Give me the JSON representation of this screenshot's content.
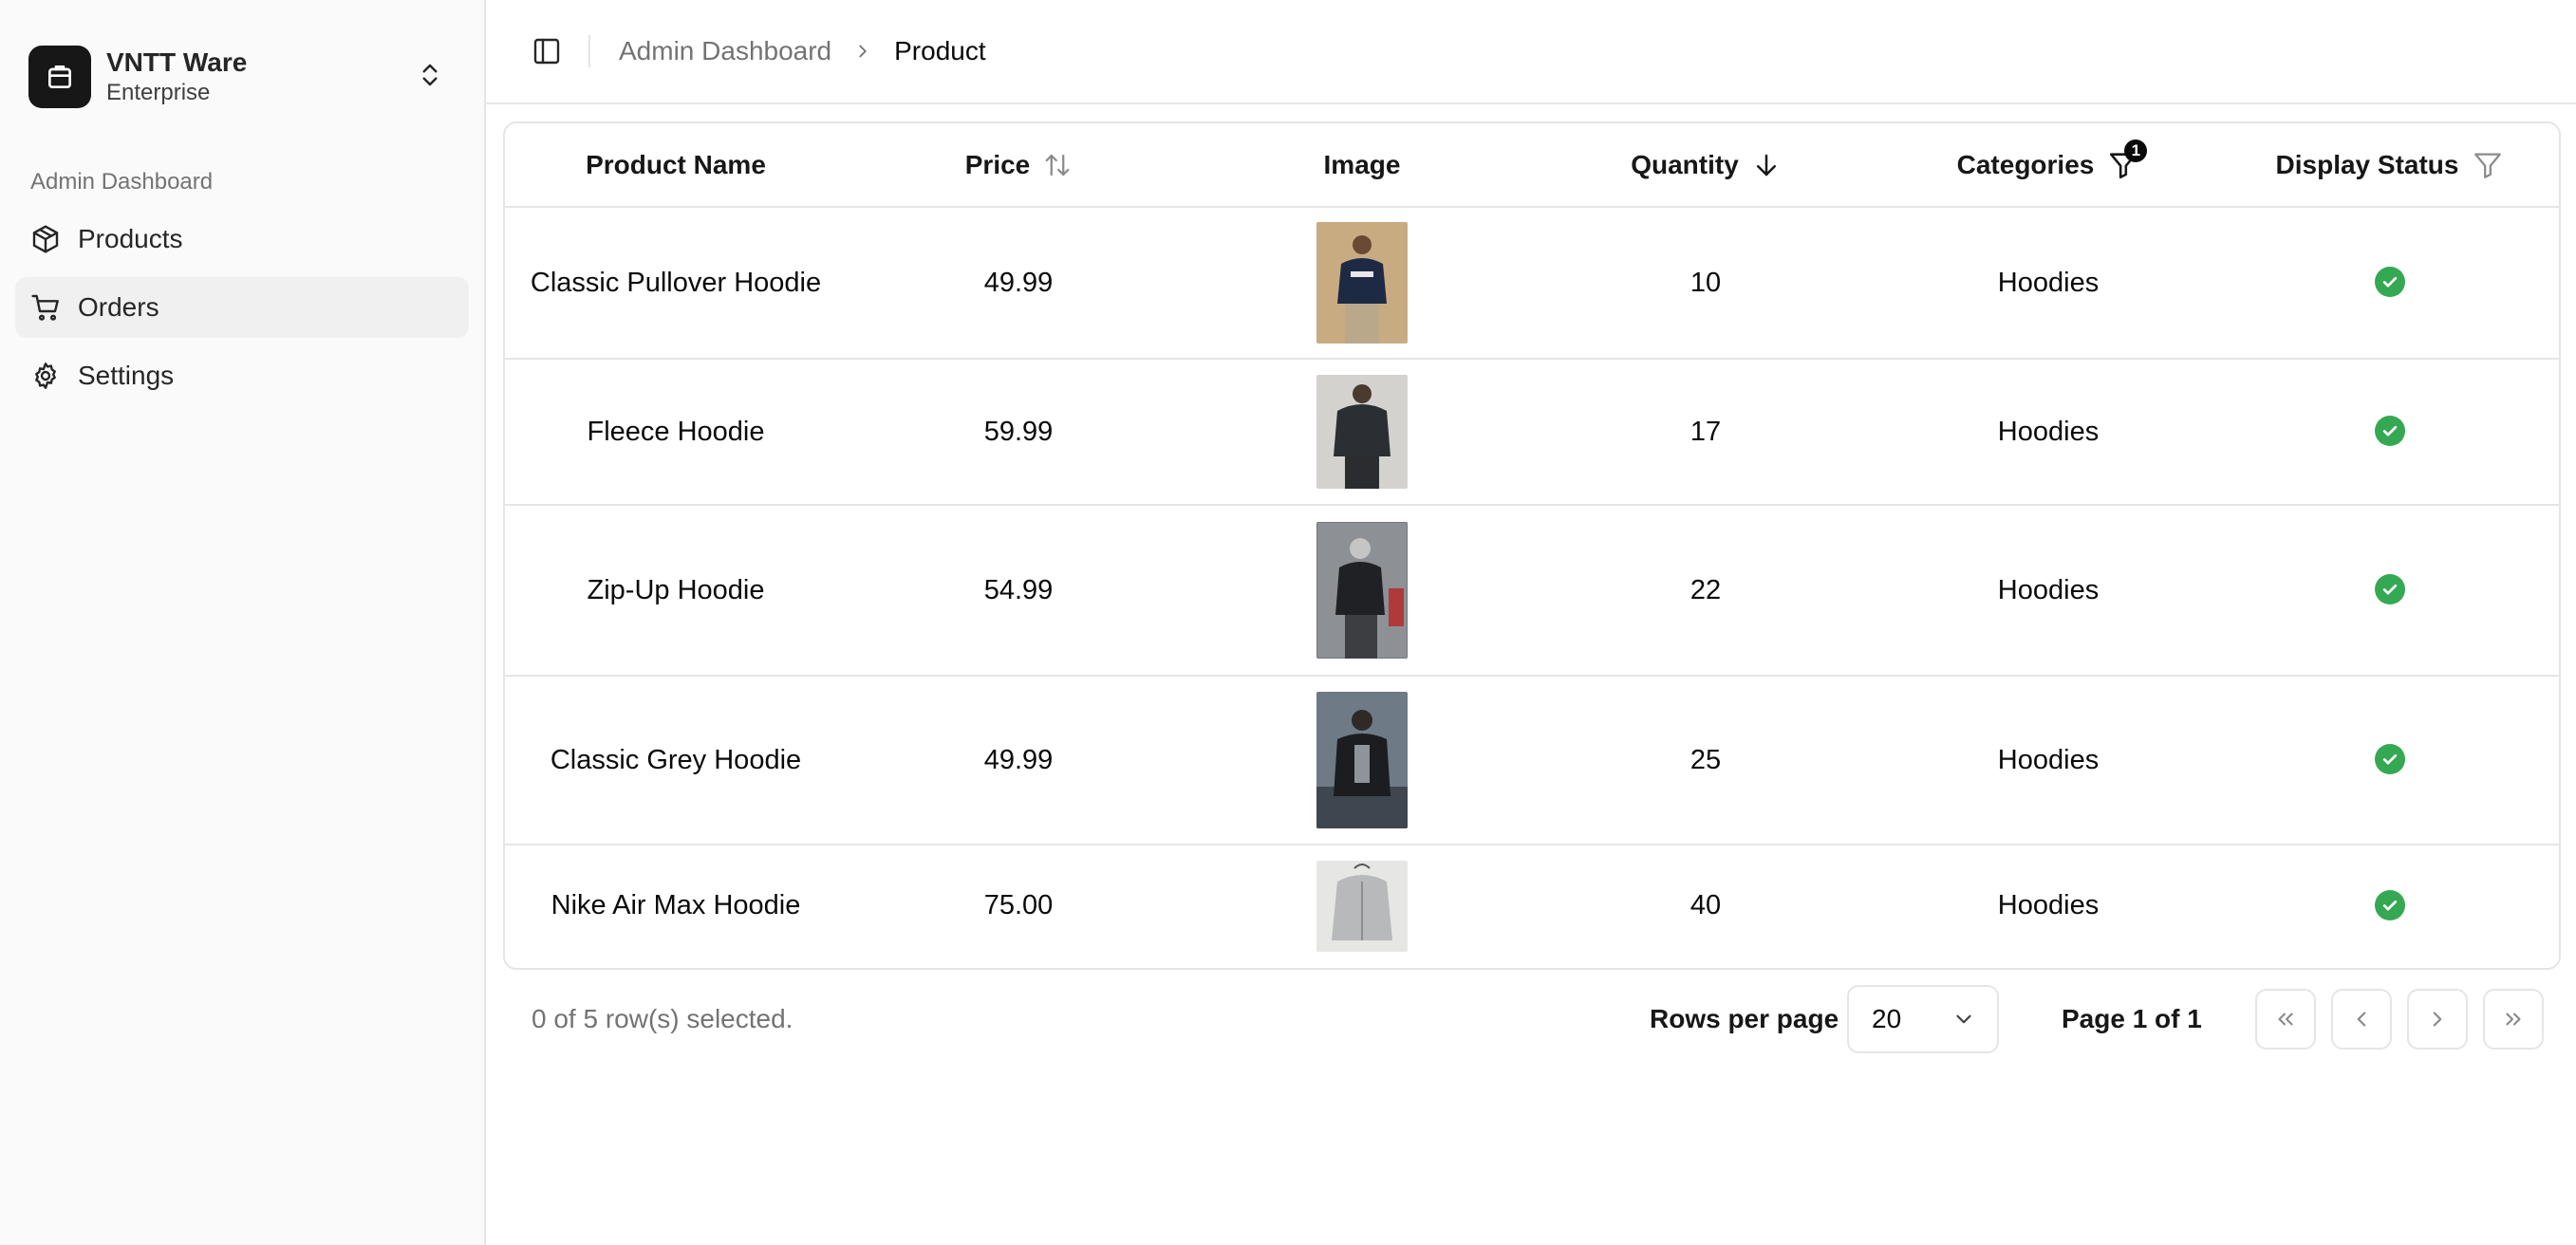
{
  "sidebar": {
    "team_name": "VNTT Ware",
    "team_plan": "Enterprise",
    "group_label": "Admin Dashboard",
    "items": [
      {
        "label": "Products",
        "icon": "package-icon"
      },
      {
        "label": "Orders",
        "icon": "shopping-cart-icon",
        "active": true
      },
      {
        "label": "Settings",
        "icon": "gear-icon"
      }
    ]
  },
  "header": {
    "breadcrumb_parent": "Admin Dashboard",
    "breadcrumb_current": "Product"
  },
  "table": {
    "columns": {
      "name": "Product Name",
      "price": "Price",
      "image": "Image",
      "quantity": "Quantity",
      "categories": "Categories",
      "status": "Display Status"
    },
    "categories_filter_count": "1",
    "rows": [
      {
        "name": "Classic Pullover Hoodie",
        "price": "49.99",
        "quantity": "10",
        "category": "Hoodies",
        "status": "visible",
        "image_icon": "hoodie-photo-navy"
      },
      {
        "name": "Fleece Hoodie",
        "price": "59.99",
        "quantity": "17",
        "category": "Hoodies",
        "status": "visible",
        "image_icon": "hoodie-photo-black"
      },
      {
        "name": "Zip-Up Hoodie",
        "price": "54.99",
        "quantity": "22",
        "category": "Hoodies",
        "status": "visible",
        "image_icon": "hoodie-photo-grey-zip"
      },
      {
        "name": "Classic Grey Hoodie",
        "price": "49.99",
        "quantity": "25",
        "category": "Hoodies",
        "status": "visible",
        "image_icon": "hoodie-photo-outdoor"
      },
      {
        "name": "Nike Air Max Hoodie",
        "price": "75.00",
        "quantity": "40",
        "category": "Hoodies",
        "status": "visible",
        "image_icon": "hoodie-photo-light-grey"
      }
    ]
  },
  "footer": {
    "selected_text": "0 of 5 row(s) selected.",
    "rows_per_page_label": "Rows per page",
    "rows_per_page_value": "20",
    "page_label": "Page 1 of 1"
  },
  "colors": {
    "status_ok": "#35a853",
    "sidebar_bg": "#fafafa",
    "active_item_bg": "#f0f0f1"
  }
}
